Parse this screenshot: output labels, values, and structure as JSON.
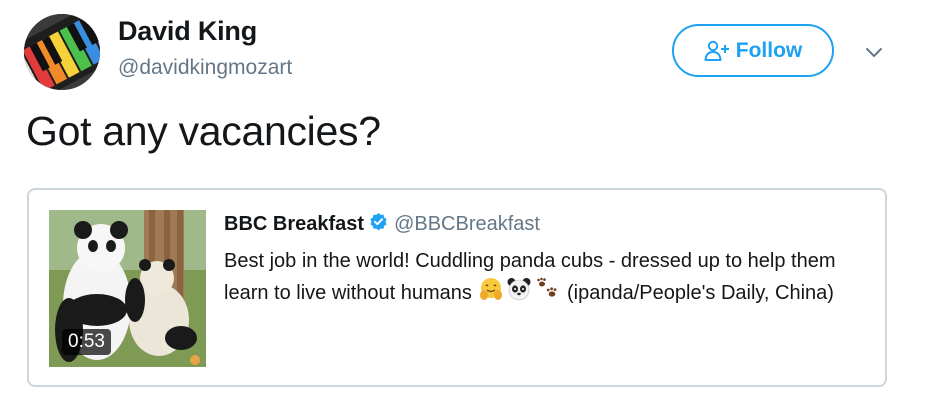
{
  "author": {
    "name": "David King",
    "handle": "@davidkingmozart"
  },
  "follow_button": {
    "label": "Follow"
  },
  "tweet": {
    "text": "Got any vacancies?"
  },
  "quoted_tweet": {
    "name": "BBC Breakfast",
    "handle": "@BBCBreakfast",
    "body_part1": "Best job in the world! Cuddling panda cubs - dressed up to help them learn to live without humans ",
    "body_part2": " (ipanda/People's Daily, China)",
    "emojis": [
      "hugging-face",
      "panda-face",
      "paw-prints"
    ],
    "video_duration": "0:53"
  },
  "colors": {
    "accent": "#1da1f2",
    "text": "#14171a",
    "secondary": "#657786",
    "border": "#ccd6dd"
  }
}
